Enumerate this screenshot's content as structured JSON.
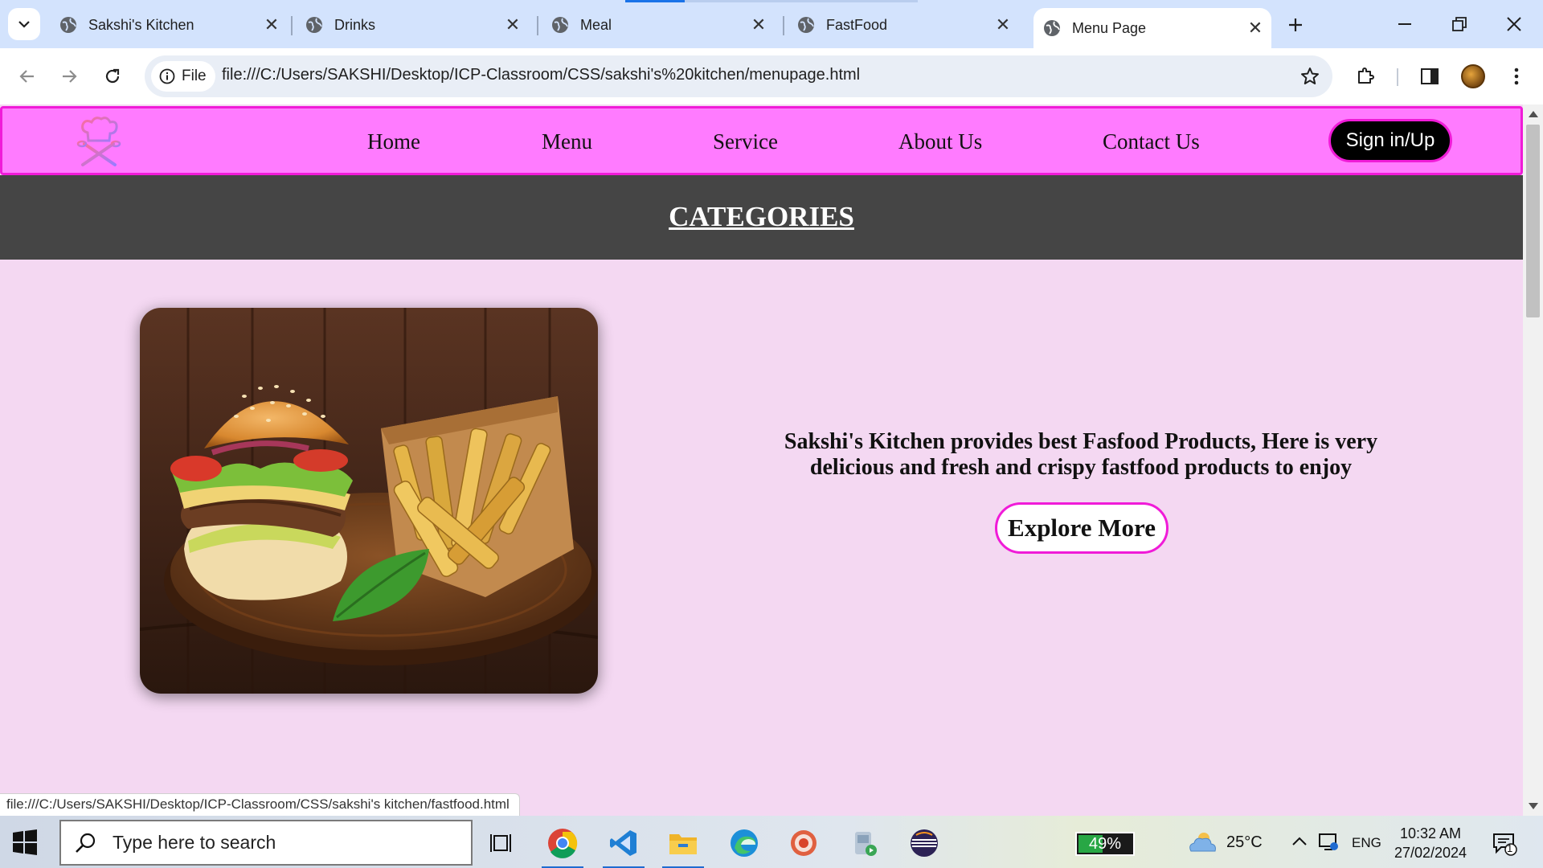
{
  "browser": {
    "tabs": [
      {
        "title": "Sakshi's Kitchen",
        "active": false
      },
      {
        "title": "Drinks",
        "active": false
      },
      {
        "title": "Meal",
        "active": false
      },
      {
        "title": "FastFood",
        "active": false
      },
      {
        "title": "Menu Page",
        "active": true
      }
    ],
    "site_chip_label": "File",
    "url": "file:///C:/Users/SAKSHI/Desktop/ICP-Classroom/CSS/sakshi's%20kitchen/menupage.html",
    "status_url": "file:///C:/Users/SAKSHI/Desktop/ICP-Classroom/CSS/sakshi's kitchen/fastfood.html"
  },
  "page": {
    "nav": {
      "links": [
        "Home",
        "Menu",
        "Service",
        "About Us",
        "Contact Us"
      ],
      "signin_label": "Sign in/Up"
    },
    "categories_title": "CATEGORIES",
    "description": "Sakshi's Kitchen provides best Fasfood Products, Here is very delicious and fresh and crispy fastfood products to enjoy",
    "explore_label": "Explore More",
    "colors": {
      "navbar_bg": "#ff7bff",
      "accent_border": "#f01bd8",
      "band_bg": "#454545",
      "page_bg": "#f4d8f2"
    }
  },
  "taskbar": {
    "search_placeholder": "Type here to search",
    "battery_percent": 49,
    "battery_label": "49%",
    "temperature": "25°C",
    "language": "ENG",
    "time": "10:32 AM",
    "date": "27/02/2024",
    "notification_count": "1"
  }
}
